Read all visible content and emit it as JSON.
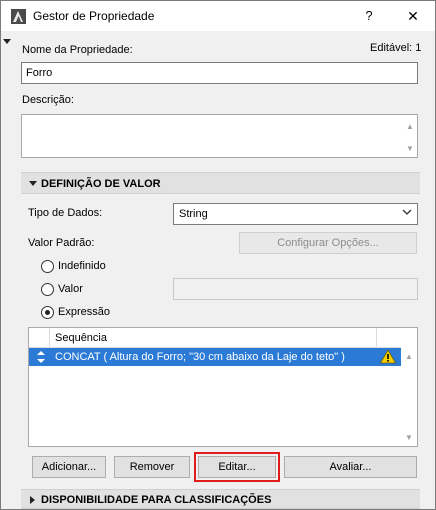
{
  "window": {
    "title": "Gestor de Propriedade",
    "help_label": "?",
    "close_label": "✕"
  },
  "property": {
    "name_label": "Nome da Propriedade:",
    "editable_label": "Editável: 1",
    "name_value": "Forro",
    "description_label": "Descrição:",
    "description_value": ""
  },
  "value_definition": {
    "section_title": "DEFINIÇÃO DE VALOR",
    "data_type_label": "Tipo de Dados:",
    "data_type_value": "String",
    "default_value_label": "Valor Padrão:",
    "configure_options_label": "Configurar Opções...",
    "radio_undefined_label": "Indefinido",
    "radio_value_label": "Valor",
    "radio_expression_label": "Expressão",
    "selected_radio": "Expressão",
    "value_input": "",
    "list_header": "Sequência",
    "rows": [
      {
        "text": "CONCAT ( Altura do Forro; \"30 cm abaixo da Laje do teto\" )",
        "warning": true
      }
    ],
    "buttons": {
      "add": "Adicionar...",
      "remove": "Remover",
      "edit": "Editar...",
      "evaluate": "Avaliar..."
    }
  },
  "availability": {
    "section_title": "DISPONIBILIDADE PARA CLASSIFICAÇÕES"
  },
  "colors": {
    "selection": "#2b7bd6",
    "highlight_outline": "#e01b1b",
    "warning_fill": "#f5d000"
  },
  "icons": {
    "app": "archicad-app-icon",
    "warning": "warning-icon",
    "drag": "drag-handle-icon"
  }
}
